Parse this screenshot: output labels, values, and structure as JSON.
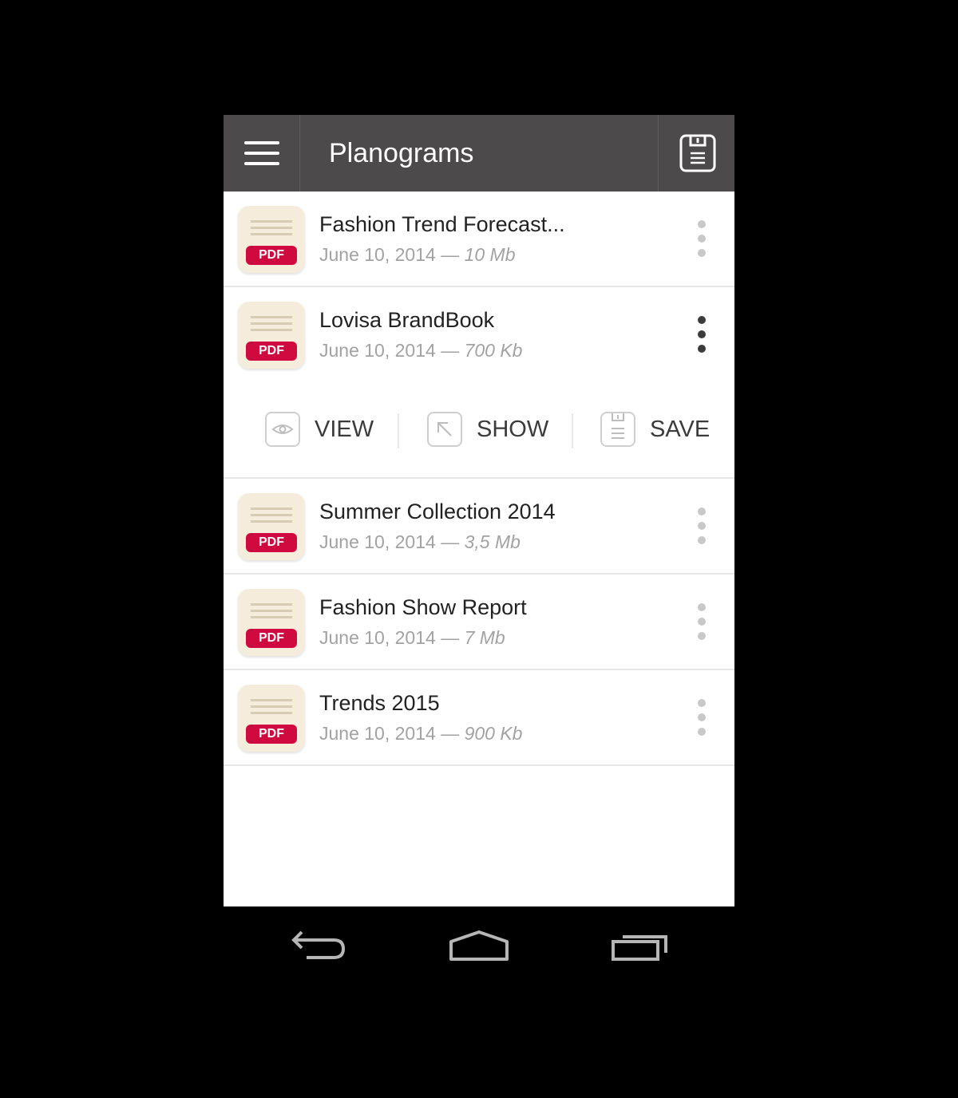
{
  "header": {
    "title": "Planograms"
  },
  "files": [
    {
      "name": "Fashion Trend Forecast...",
      "date": "June 10, 2014",
      "separator": "—",
      "size": "10 Mb",
      "badge": "PDF"
    },
    {
      "name": "Lovisa BrandBook",
      "date": "June 10, 2014",
      "separator": "—",
      "size": "700 Kb",
      "badge": "PDF"
    },
    {
      "name": "Summer Collection 2014",
      "date": "June 10, 2014",
      "separator": "—",
      "size": "3,5 Mb",
      "badge": "PDF"
    },
    {
      "name": "Fashion Show Report",
      "date": "June 10, 2014",
      "separator": "—",
      "size": "7 Mb",
      "badge": "PDF"
    },
    {
      "name": "Trends 2015",
      "date": "June 10, 2014",
      "separator": "—",
      "size": "900 Kb",
      "badge": "PDF"
    }
  ],
  "actions": {
    "view": "VIEW",
    "show": "SHOW",
    "save": "SAVE"
  },
  "colors": {
    "appbar": "#4c4a4a",
    "pdf_badge": "#cf0a3f",
    "icon_bg": "#f5ecdb"
  },
  "icons": [
    "menu-icon",
    "save-icon",
    "eye-icon",
    "arrow-up-left-icon",
    "back-icon",
    "home-icon",
    "recent-apps-icon"
  ]
}
